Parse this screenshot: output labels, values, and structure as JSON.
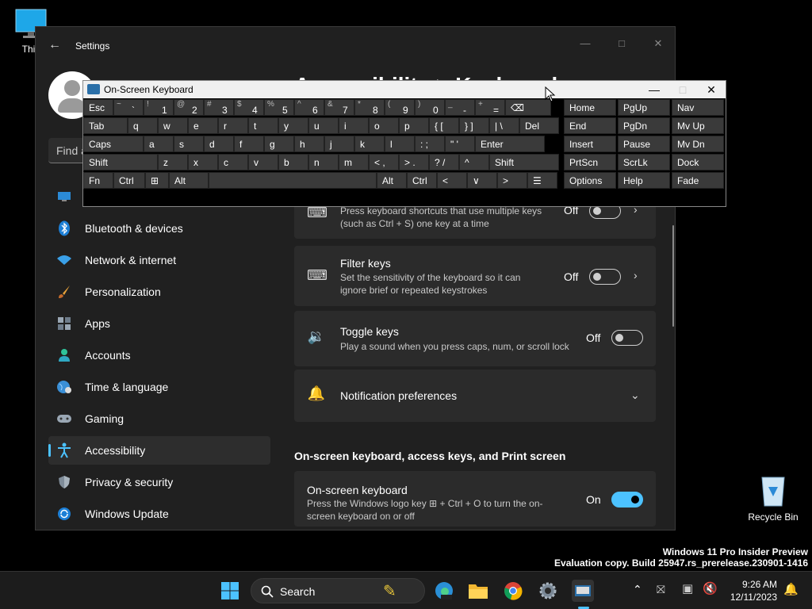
{
  "desktop": {
    "this_pc_label": "This",
    "recycle_bin_label": "Recycle Bin",
    "watermark_line1": "Windows 11 Pro Insider Preview",
    "watermark_line2": "Evaluation copy. Build 25947.rs_prerelease.230901-1416"
  },
  "settings": {
    "title": "Settings",
    "heading_peek": "Accessibility > Keyboard",
    "find_placeholder": "Find a",
    "nav": [
      {
        "label": "Bluetooth & devices",
        "icon": "bluetooth-icon"
      },
      {
        "label": "Network & internet",
        "icon": "wifi-icon"
      },
      {
        "label": "Personalization",
        "icon": "brush-icon"
      },
      {
        "label": "Apps",
        "icon": "apps-icon"
      },
      {
        "label": "Accounts",
        "icon": "person-icon"
      },
      {
        "label": "Time & language",
        "icon": "globe-icon"
      },
      {
        "label": "Gaming",
        "icon": "gamepad-icon"
      },
      {
        "label": "Accessibility",
        "icon": "accessibility-icon",
        "active": true
      },
      {
        "label": "Privacy & security",
        "icon": "shield-icon"
      },
      {
        "label": "Windows Update",
        "icon": "update-icon"
      }
    ],
    "sticky_keys": {
      "desc1": "Press keyboard shortcuts that use multiple keys",
      "desc2": "(such as Ctrl + S) one key at a time",
      "state": "Off"
    },
    "filter_keys": {
      "title": "Filter keys",
      "desc1": "Set the sensitivity of the keyboard so it can",
      "desc2": "ignore brief or repeated keystrokes",
      "state": "Off"
    },
    "toggle_keys": {
      "title": "Toggle keys",
      "desc": "Play a sound when you press caps, num, or scroll lock",
      "state": "Off"
    },
    "notification_preferences": "Notification preferences",
    "section_title": "On-screen keyboard, access keys, and Print screen",
    "osk_setting": {
      "title": "On-screen keyboard",
      "desc1": "Press the Windows logo key ⊞ + Ctrl + O to turn the on-",
      "desc2": "screen keyboard on or off",
      "state": "On"
    }
  },
  "osk": {
    "title": "On-Screen Keyboard",
    "row1": [
      {
        "sh": "",
        "m": "Esc"
      },
      {
        "sh": "~",
        "m": "`"
      },
      {
        "sh": "!",
        "m": "1"
      },
      {
        "sh": "@",
        "m": "2"
      },
      {
        "sh": "#",
        "m": "3"
      },
      {
        "sh": "$",
        "m": "4"
      },
      {
        "sh": "%",
        "m": "5"
      },
      {
        "sh": "^",
        "m": "6"
      },
      {
        "sh": "&",
        "m": "7"
      },
      {
        "sh": "*",
        "m": "8"
      },
      {
        "sh": "(",
        "m": "9"
      },
      {
        "sh": ")",
        "m": "0"
      },
      {
        "sh": "_",
        "m": "-"
      },
      {
        "sh": "+",
        "m": "="
      },
      {
        "sh": "",
        "m": "⌫"
      }
    ],
    "row2": [
      "Tab",
      "q",
      "w",
      "e",
      "r",
      "t",
      "y",
      "u",
      "i",
      "o",
      "p",
      "{ [",
      "} ]",
      "| \\",
      "Del"
    ],
    "row3": [
      "Caps",
      "a",
      "s",
      "d",
      "f",
      "g",
      "h",
      "j",
      "k",
      "l",
      ": ;",
      "\" '",
      "Enter"
    ],
    "row4": [
      "Shift",
      "z",
      "x",
      "c",
      "v",
      "b",
      "n",
      "m",
      "< ,",
      "> .",
      "? /",
      "^",
      "Shift"
    ],
    "row5": [
      "Fn",
      "Ctrl",
      "⊞",
      "Alt",
      "",
      "Alt",
      "Ctrl",
      "<",
      "∨",
      ">",
      "☰"
    ],
    "nav_keys": [
      [
        "Home",
        "PgUp",
        "Nav"
      ],
      [
        "End",
        "PgDn",
        "Mv Up"
      ],
      [
        "Insert",
        "Pause",
        "Mv Dn"
      ],
      [
        "PrtScn",
        "ScrLk",
        "Dock"
      ],
      [
        "Options",
        "Help",
        "Fade"
      ]
    ]
  },
  "taskbar": {
    "search_label": "Search",
    "time": "9:26 AM",
    "date": "12/11/2023"
  },
  "colors": {
    "accent": "#4cc2ff",
    "card": "#2b2b2b",
    "window_bg": "#202020"
  }
}
